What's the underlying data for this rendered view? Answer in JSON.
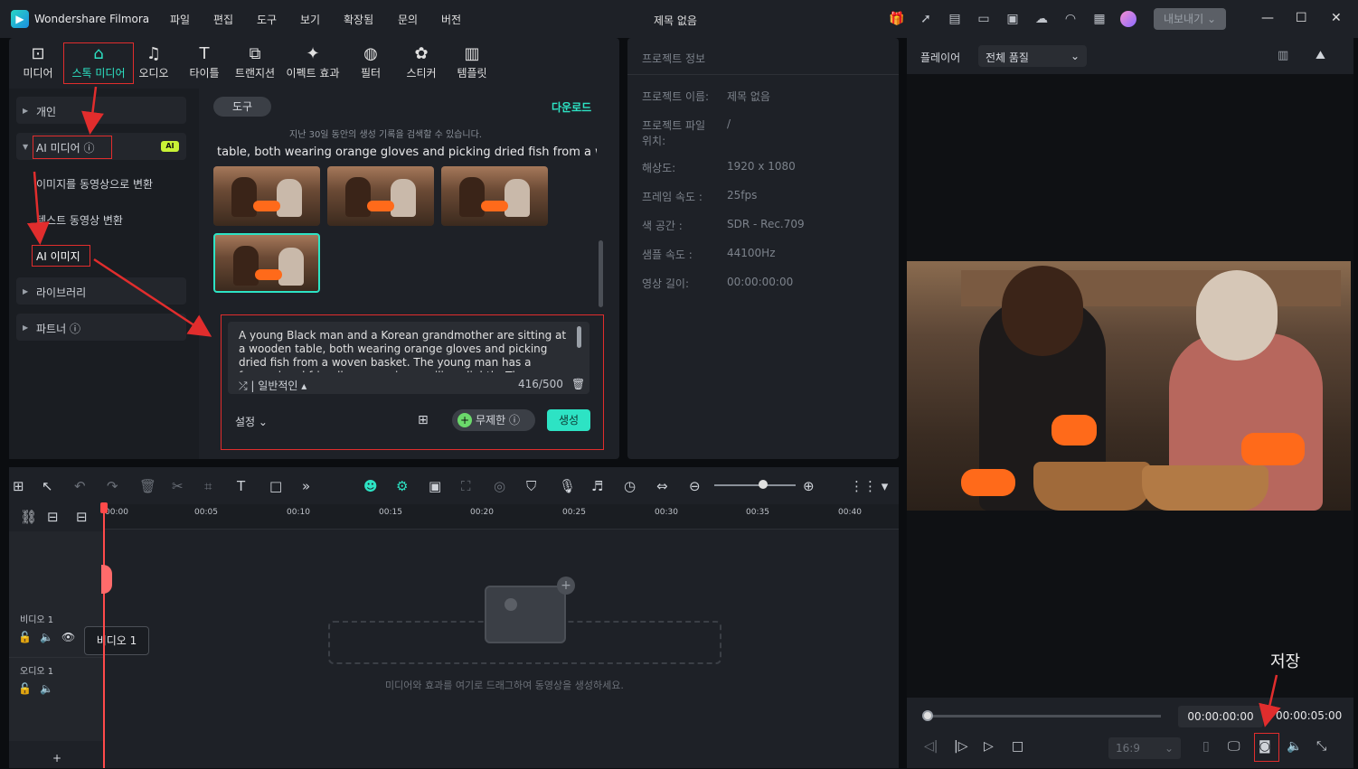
{
  "titlebar": {
    "app_name": "Wondershare Filmora",
    "menus": [
      "파일",
      "편집",
      "도구",
      "보기",
      "확장됨",
      "문의",
      "버전"
    ],
    "doc_title": "제목 없음",
    "export_label": "내보내기"
  },
  "toolbar": {
    "tabs": [
      "미디어",
      "스톡 미디어",
      "오디오",
      "타이틀",
      "트랜지션",
      "이펙트 효과",
      "필터",
      "스티커",
      "템플릿"
    ]
  },
  "nav": {
    "personal": "개인",
    "ai_media": "AI 미디어",
    "ai_badge": "AI",
    "img_to_video": "이미지를 동영상으로 변환",
    "text_to_video": "텍스트 동영상 변환",
    "ai_image": "AI 이미지",
    "library": "라이브러리",
    "partner": "파트너"
  },
  "content": {
    "tool_pill": "도구",
    "download": "다운로드",
    "history_hint": "지난 30일 동안의 생성 기록을 검색할 수 있습니다.",
    "prompt_preview": "table, both wearing orange gloves and picking dried fish from a wov...",
    "prompt_text": "A young Black man and a Korean grandmother are sitting at a wooden table, both wearing orange gloves and picking dried fish from a woven basket. The young man has a focused and friendly expression, smiling slightly. The grandmother's face is wrinkled and",
    "style": "일반적인",
    "char_count": "416/500",
    "settings": "설정",
    "unlimited": "무제한",
    "generate": "생성"
  },
  "project": {
    "header": "프로젝트 정보",
    "rows": [
      {
        "label": "프로젝트 이름:",
        "value": "제목 없음"
      },
      {
        "label": "프로젝트 파일 위치:",
        "value": "/"
      },
      {
        "label": "해상도:",
        "value": "1920 x 1080"
      },
      {
        "label": "프레임 속도 :",
        "value": "25fps"
      },
      {
        "label": "색 공간 :",
        "value": "SDR - Rec.709"
      },
      {
        "label": "샘플 속도 :",
        "value": "44100Hz"
      },
      {
        "label": "영상 길이:",
        "value": "00:00:00:00"
      }
    ]
  },
  "player": {
    "title": "플레이어",
    "quality": "전체 품질",
    "timecode_current": "00:00:00:00",
    "timecode_total": "00:00:05:00",
    "ratio": "16:9",
    "save_annotation": "저장"
  },
  "timeline": {
    "ticks": [
      "00:00",
      "00:05",
      "00:10",
      "00:15",
      "00:20",
      "00:25",
      "00:30",
      "00:35",
      "00:40"
    ],
    "video_track": "비디오 1",
    "audio_track": "오디오 1",
    "tooltip": "비디오 1",
    "drop_hint": "미디어와 효과를 여기로 드래그하여 동영상을 생성하세요.",
    "add_track": "+"
  },
  "colors": {
    "accent": "#2de3c4",
    "annotation": "#e12d2d",
    "panel": "#1e2127"
  }
}
